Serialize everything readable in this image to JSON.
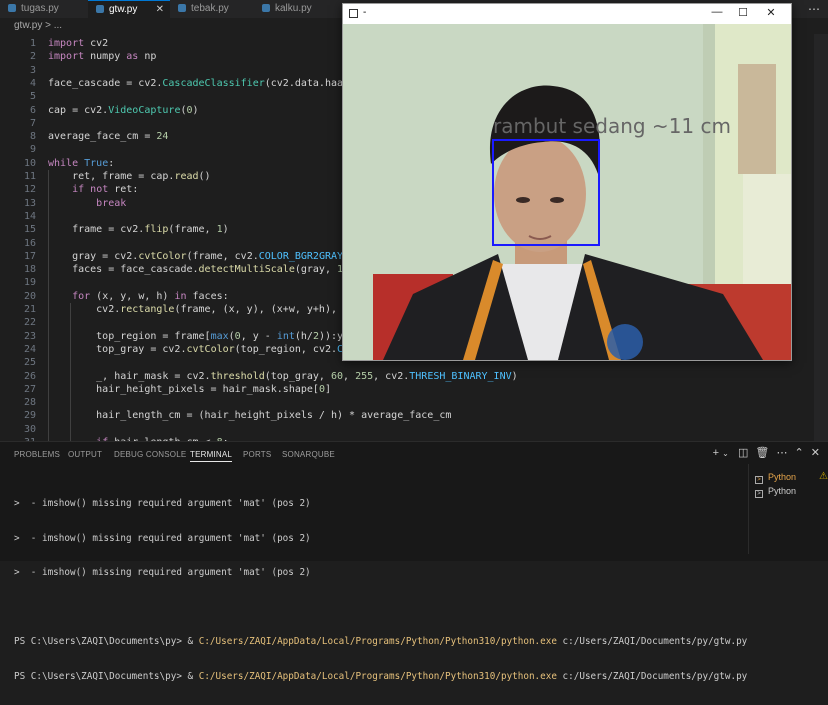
{
  "tabs": [
    {
      "label": "tugas.py",
      "active": false
    },
    {
      "label": "gtw.py",
      "active": true
    },
    {
      "label": "tebak.py",
      "active": false
    },
    {
      "label": "kalku.py",
      "active": false
    }
  ],
  "breadcrumb": "gtw.py > ...",
  "editor": {
    "line_numbers": [
      "1",
      "2",
      "3",
      "4",
      "5",
      "6",
      "7",
      "8",
      "9",
      "10",
      "11",
      "12",
      "13",
      "14",
      "15",
      "16",
      "17",
      "18",
      "19",
      "20",
      "21",
      "22",
      "23",
      "24",
      "25",
      "26",
      "27",
      "28",
      "29",
      "30",
      "31"
    ],
    "lines": [
      "import cv2",
      "import numpy as np",
      "",
      "face_cascade = cv2.CascadeClassifier(cv2.data.haarcasca",
      "",
      "cap = cv2.VideoCapture(0)",
      "",
      "average_face_cm = 24",
      "",
      "while True:",
      "    ret, frame = cap.read()",
      "    if not ret:",
      "        break",
      "",
      "    frame = cv2.flip(frame, 1)",
      "",
      "    gray = cv2.cvtColor(frame, cv2.COLOR_BGR2GRAY)",
      "    faces = face_cascade.detectMultiScale(gray, 1.3, 5)",
      "",
      "    for (x, y, w, h) in faces:",
      "        cv2.rectangle(frame, (x, y), (x+w, y+h), (255,",
      "",
      "        top_region = frame[max(0, y - int(h/2)):y, x:x+",
      "        top_gray = cv2.cvtColor(top_region, cv2.COLOR_B",
      "",
      "        _, hair_mask = cv2.threshold(top_gray, 60, 255, cv2.THRESH_BINARY_INV)",
      "        hair_height_pixels = hair_mask.shape[0]",
      "",
      "        hair_length_cm = (hair_height_pixels / h) * average_face_cm",
      "",
      "        if hair_length_cm < 8:"
    ]
  },
  "panel": {
    "tabs": [
      "PROBLEMS",
      "OUTPUT",
      "DEBUG CONSOLE",
      "TERMINAL",
      "PORTS",
      "SONARQUBE"
    ],
    "active_tab": "TERMINAL",
    "terminal_lines": [
      ">  - imshow() missing required argument 'mat' (pos 2)",
      ">  - imshow() missing required argument 'mat' (pos 2)",
      ">  - imshow() missing required argument 'mat' (pos 2)"
    ],
    "commands": [
      {
        "prompt": "PS C:\\Users\\ZAQI\\Documents\\py> & ",
        "exe": "C:/Users/ZAQI/AppData/Local/Programs/Python/Python310/python.exe",
        "arg": " c:/Users/ZAQI/Documents/py/gtw.py"
      },
      {
        "prompt": "PS C:\\Users\\ZAQI\\Documents\\py> & ",
        "exe": "C:/Users/ZAQI/AppData/Local/Programs/Python/Python310/python.exe",
        "arg": " c:/Users/ZAQI/Documents/py/gtw.py"
      }
    ],
    "terminals": [
      "Python",
      "Python"
    ]
  },
  "camera_window": {
    "title": "-",
    "overlay_text": "rambut sedang ~11 cm",
    "box_color": "#1a1aff"
  }
}
